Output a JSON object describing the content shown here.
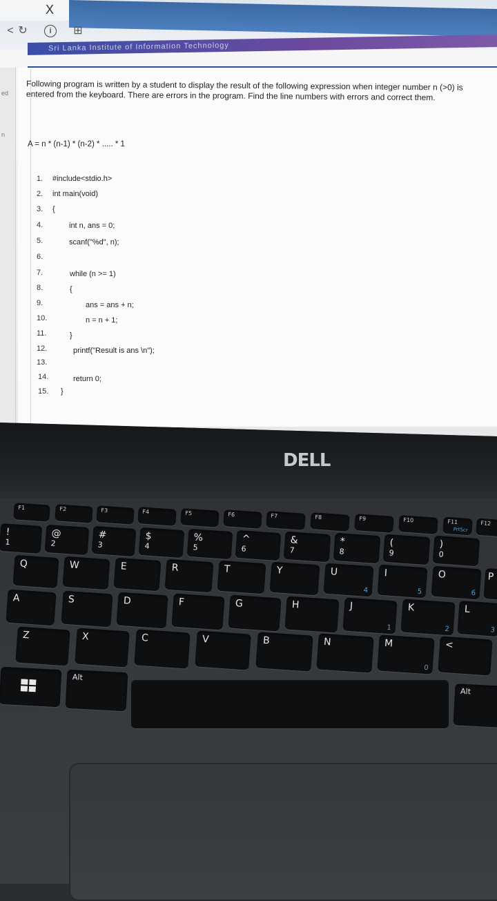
{
  "browser": {
    "close_glyph": "X",
    "banner_text": "Sri Lanka Institute of Information Technology"
  },
  "rail": {
    "label_1": "ed",
    "label_2": "n"
  },
  "question": {
    "text": "Following program is written by a student to display the result of the following expression when integer number n (>0) is entered from the keyboard. There are errors in the program. Find the line numbers with errors and correct them.",
    "formula": "A = n * (n-1) * (n-2) * ..... * 1"
  },
  "code": [
    {
      "num": "1.",
      "text": "#include<stdio.h>"
    },
    {
      "num": "2.",
      "text": "int main(void)"
    },
    {
      "num": "3.",
      "text": "{"
    },
    {
      "num": "4.",
      "text": "int n, ans = 0;"
    },
    {
      "num": "5.",
      "text": "scanf(\"%d\", n);"
    },
    {
      "num": "6.",
      "text": ""
    },
    {
      "num": "7.",
      "text": "while (n >= 1)"
    },
    {
      "num": "8.",
      "text": "{"
    },
    {
      "num": "9.",
      "text": "ans = ans + n;"
    },
    {
      "num": "10.",
      "text": "n = n + 1;"
    },
    {
      "num": "11.",
      "text": "}"
    },
    {
      "num": "12.",
      "text": "printf(\"Result is ans \\n\");"
    },
    {
      "num": "13.",
      "text": ""
    },
    {
      "num": "14.",
      "text": "return 0;"
    },
    {
      "num": "15.",
      "text": "}"
    }
  ],
  "laptop": {
    "brand": "DELL",
    "fkeys": [
      "F1",
      "F2",
      "F3",
      "F4",
      "F5",
      "F6",
      "F7",
      "F8",
      "F9",
      "F10",
      "F11",
      "F12"
    ],
    "f11_sub": "PrtScr",
    "num_row": [
      "!",
      "@",
      "#",
      "$",
      "%",
      "^",
      "&",
      "*",
      "(",
      ")"
    ],
    "num_row_digits": [
      "1",
      "2",
      "3",
      "4",
      "5",
      "6",
      "7",
      "8",
      "9",
      "0"
    ],
    "row_q": [
      "Q",
      "W",
      "E",
      "R",
      "T",
      "Y",
      "U",
      "I",
      "O",
      "P"
    ],
    "row_q_sub": {
      "U": "4",
      "I": "5",
      "O": "6"
    },
    "row_a": [
      "A",
      "S",
      "D",
      "F",
      "G",
      "H",
      "J",
      "K",
      "L"
    ],
    "row_a_sub": {
      "J": "1",
      "K": "2",
      "L": "3"
    },
    "row_z": [
      "Z",
      "X",
      "C",
      "V",
      "B",
      "N",
      "M",
      "<"
    ],
    "row_z_sub": {
      "M": "0"
    },
    "alt_left": "Alt",
    "alt_right": "Alt"
  }
}
